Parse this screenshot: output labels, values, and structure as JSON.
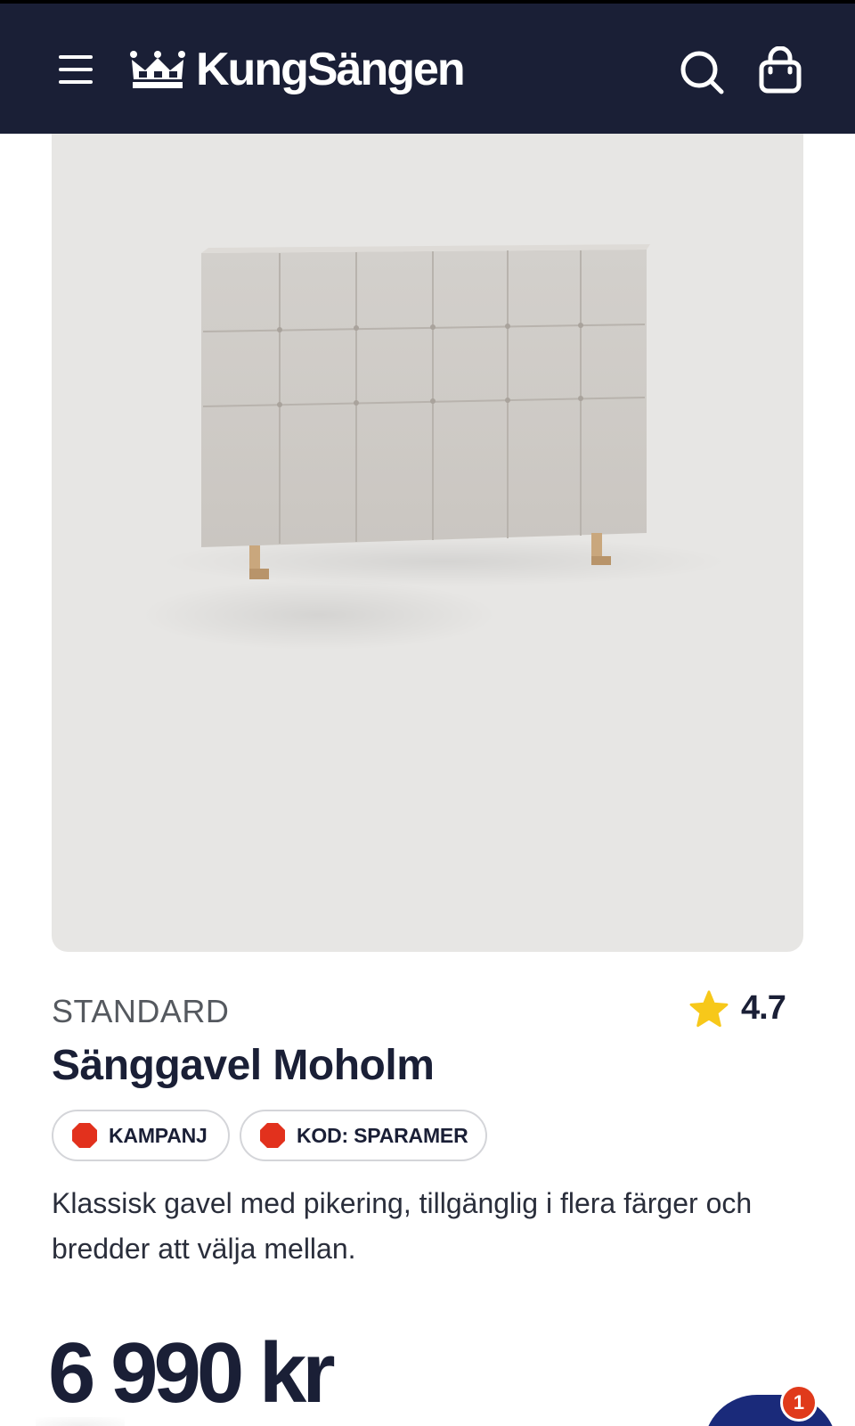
{
  "header": {
    "logo_text": "KungSängen",
    "colors": {
      "background": "#1a1f36",
      "foreground": "#ffffff"
    },
    "icons": {
      "menu": "hamburger-menu-icon",
      "logo": "crown-icon",
      "search": "search-icon",
      "cart": "shopping-bag-icon"
    }
  },
  "product": {
    "image_alt": "Upholstered tufted headboard with wooden legs",
    "brand": "STANDARD",
    "rating": "4.7",
    "title": "Sänggavel Moholm",
    "badges": [
      {
        "label": "KAMPANJ",
        "dot_color": "#e2311d"
      },
      {
        "label": "KOD: SPARAMER",
        "dot_color": "#e2311d"
      }
    ],
    "description": "Klassisk gavel med pikering, tillgänglig i flera färger och bredder att välja mellan.",
    "price": "6 990 kr"
  },
  "chat": {
    "notification_count": "1",
    "colors": {
      "button": "#1a2a7a",
      "badge": "#e03a1b"
    }
  },
  "colors": {
    "accent": "#1a1f36",
    "star": "#f7c81a"
  }
}
